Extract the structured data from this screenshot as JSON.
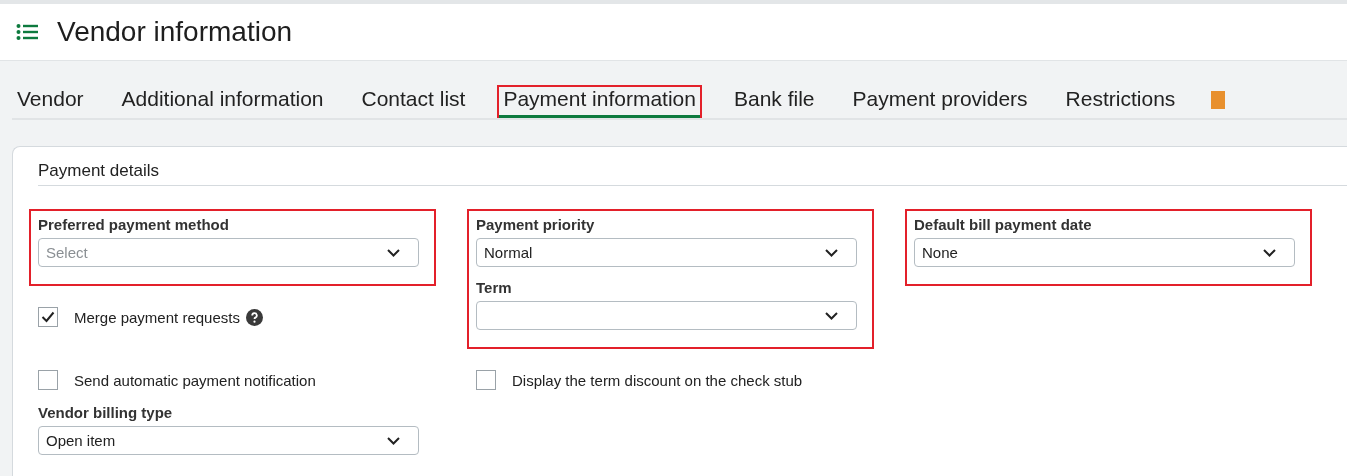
{
  "page": {
    "title": "Vendor information"
  },
  "tabs": [
    {
      "label": "Vendor",
      "selected": false,
      "highlighted": false
    },
    {
      "label": "Additional information",
      "selected": false,
      "highlighted": false
    },
    {
      "label": "Contact list",
      "selected": false,
      "highlighted": false
    },
    {
      "label": "Payment information",
      "selected": true,
      "highlighted": true
    },
    {
      "label": "Bank file",
      "selected": false,
      "highlighted": false
    },
    {
      "label": "Payment providers",
      "selected": false,
      "highlighted": false
    },
    {
      "label": "Restrictions",
      "selected": false,
      "highlighted": false
    }
  ],
  "section": {
    "title": "Payment details"
  },
  "columns": [
    {
      "groups": [
        {
          "highlighted": true,
          "items": [
            {
              "kind": "select",
              "label": "Preferred payment method",
              "placeholder": "Select"
            }
          ]
        },
        {
          "highlighted": false,
          "items": [
            {
              "kind": "checkbox",
              "label": "Merge payment requests",
              "checked": true,
              "help": true
            },
            {
              "kind": "checkbox",
              "label": "Send automatic payment notification",
              "checked": false,
              "help": false
            },
            {
              "kind": "select",
              "label": "Vendor billing type",
              "value": "Open item"
            }
          ]
        }
      ]
    },
    {
      "groups": [
        {
          "highlighted": true,
          "items": [
            {
              "kind": "select",
              "label": "Payment priority",
              "value": "Normal"
            },
            {
              "kind": "select",
              "label": "Term"
            }
          ]
        },
        {
          "highlighted": false,
          "items": [
            {
              "kind": "checkbox",
              "label": "Display the term discount on the check stub",
              "checked": false,
              "help": false
            }
          ]
        }
      ]
    },
    {
      "groups": [
        {
          "highlighted": true,
          "items": [
            {
              "kind": "select",
              "label": "Default bill payment date",
              "value": "None"
            }
          ]
        }
      ]
    }
  ]
}
